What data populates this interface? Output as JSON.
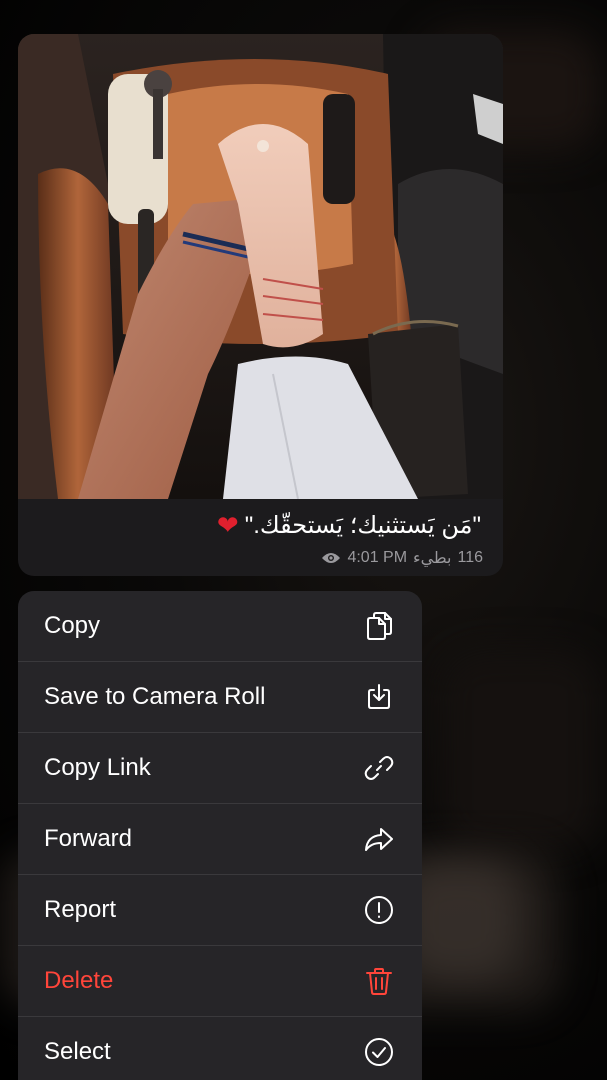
{
  "message": {
    "caption": "\"مَن يَستثنيك؛ يَستحقّك.\"",
    "caption_emoji": "❤",
    "views": "116",
    "edited_label": "بطيء",
    "time": "4:01 PM"
  },
  "menu": {
    "items": [
      {
        "label": "Copy",
        "icon": "copy-icon",
        "danger": false
      },
      {
        "label": "Save to Camera Roll",
        "icon": "save-icon",
        "danger": false
      },
      {
        "label": "Copy Link",
        "icon": "link-icon",
        "danger": false
      },
      {
        "label": "Forward",
        "icon": "forward-icon",
        "danger": false
      },
      {
        "label": "Report",
        "icon": "report-icon",
        "danger": false
      },
      {
        "label": "Delete",
        "icon": "trash-icon",
        "danger": true
      },
      {
        "label": "Select",
        "icon": "checkmark-circle-icon",
        "danger": false
      }
    ]
  },
  "colors": {
    "bubble_bg": "#1c1b1d",
    "menu_bg": "#262528",
    "danger": "#ff453a",
    "heart": "#e0202e"
  }
}
